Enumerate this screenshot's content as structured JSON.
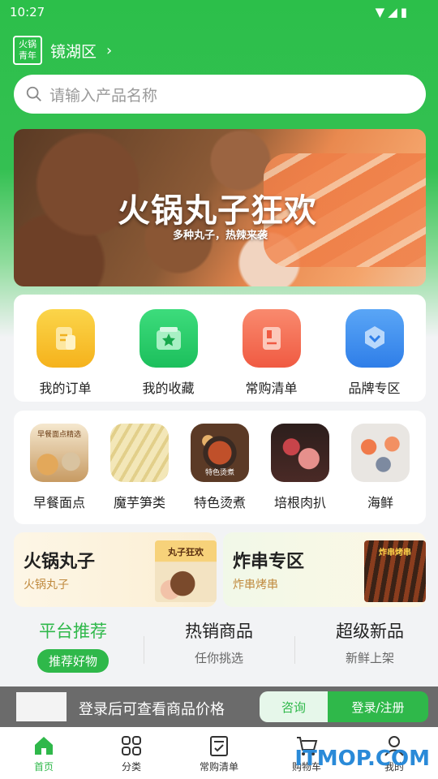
{
  "status_bar": {
    "time": "10:27"
  },
  "header": {
    "logo_text": "火锅青年",
    "district": "镜湖区"
  },
  "search": {
    "placeholder": "请输入产品名称"
  },
  "banner": {
    "title": "火锅丸子狂欢",
    "subtitle": "多种丸子，热辣来袭"
  },
  "quick_actions": [
    {
      "label": "我的订单",
      "icon": "order-icon",
      "color": "#f9c531"
    },
    {
      "label": "我的收藏",
      "icon": "favorite-icon",
      "color": "#2fcf6c"
    },
    {
      "label": "常购清单",
      "icon": "list-icon",
      "color": "#f4725a"
    },
    {
      "label": "品牌专区",
      "icon": "brand-icon",
      "color": "#3d8ff0"
    }
  ],
  "categories": [
    {
      "label": "早餐面点",
      "image_text": "早餐面点精选"
    },
    {
      "label": "魔芋笋类",
      "image_text": ""
    },
    {
      "label": "特色烫煮",
      "image_text": "特色烫煮"
    },
    {
      "label": "培根肉扒",
      "image_text": ""
    },
    {
      "label": "海鲜",
      "image_text": ""
    }
  ],
  "promos": [
    {
      "title": "火锅丸子",
      "subtitle": "火锅丸子",
      "image_text": "丸子狂欢"
    },
    {
      "title": "炸串专区",
      "subtitle": "炸串烤串",
      "image_text": "炸串烤串"
    }
  ],
  "tabs": [
    {
      "title": "平台推荐",
      "subtitle": "推荐好物",
      "active": true
    },
    {
      "title": "热销商品",
      "subtitle": "任你挑选",
      "active": false
    },
    {
      "title": "超级新品",
      "subtitle": "新鲜上架",
      "active": false
    }
  ],
  "login_bar": {
    "message": "登录后可查看商品价格",
    "consult_label": "咨询",
    "login_label": "登录/注册"
  },
  "bottom_nav": [
    {
      "label": "首页",
      "icon": "home-icon",
      "active": true
    },
    {
      "label": "分类",
      "icon": "category-icon",
      "active": false
    },
    {
      "label": "常购清单",
      "icon": "list-icon",
      "active": false
    },
    {
      "label": "购物车",
      "icon": "cart-icon",
      "active": false
    },
    {
      "label": "我的",
      "icon": "user-icon",
      "active": false
    }
  ],
  "watermark": "ITMOP.COM",
  "colors": {
    "brand_green": "#2fb84a"
  }
}
